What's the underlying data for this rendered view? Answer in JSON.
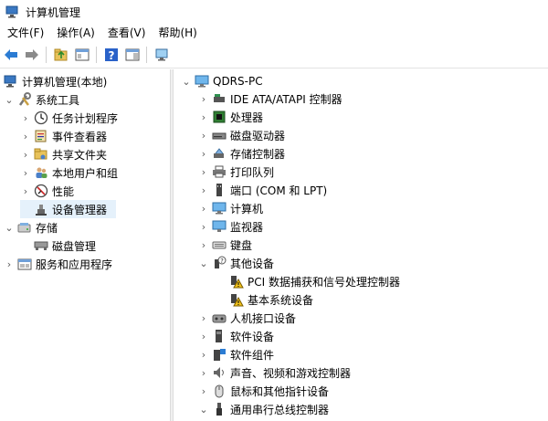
{
  "window": {
    "title": "计算机管理"
  },
  "menu": [
    {
      "label": "文件(F)"
    },
    {
      "label": "操作(A)"
    },
    {
      "label": "查看(V)"
    },
    {
      "label": "帮助(H)"
    }
  ],
  "left_tree": [
    {
      "label": "计算机管理(本地)",
      "icon": "computer-management-icon"
    },
    {
      "label": "系统工具",
      "icon": "system-tools-icon"
    },
    {
      "label": "任务计划程序",
      "icon": "clock-icon"
    },
    {
      "label": "事件查看器",
      "icon": "event-viewer-icon"
    },
    {
      "label": "共享文件夹",
      "icon": "shared-folder-icon"
    },
    {
      "label": "本地用户和组",
      "icon": "users-icon"
    },
    {
      "label": "性能",
      "icon": "performance-icon"
    },
    {
      "label": "设备管理器",
      "icon": "device-manager-icon",
      "selected": true
    },
    {
      "label": "存储",
      "icon": "storage-icon"
    },
    {
      "label": "磁盘管理",
      "icon": "disk-management-icon"
    },
    {
      "label": "服务和应用程序",
      "icon": "services-icon"
    }
  ],
  "device_tree": {
    "root": {
      "label": "QDRS-PC",
      "icon": "computer-icon"
    },
    "items": [
      {
        "label": "IDE ATA/ATAPI 控制器",
        "icon": "ide-controller-icon"
      },
      {
        "label": "处理器",
        "icon": "processor-icon"
      },
      {
        "label": "磁盘驱动器",
        "icon": "disk-drive-icon"
      },
      {
        "label": "存储控制器",
        "icon": "storage-controller-icon"
      },
      {
        "label": "打印队列",
        "icon": "printer-icon"
      },
      {
        "label": "端口 (COM 和 LPT)",
        "icon": "port-icon"
      },
      {
        "label": "计算机",
        "icon": "computer-icon"
      },
      {
        "label": "监视器",
        "icon": "monitor-icon"
      },
      {
        "label": "键盘",
        "icon": "keyboard-icon"
      },
      {
        "label": "其他设备",
        "icon": "unknown-device-icon"
      },
      {
        "label": "PCI 数据捕获和信号处理控制器",
        "icon": "warning-device-icon"
      },
      {
        "label": "基本系统设备",
        "icon": "warning-device-icon"
      },
      {
        "label": "人机接口设备",
        "icon": "hid-icon"
      },
      {
        "label": "软件设备",
        "icon": "software-device-icon"
      },
      {
        "label": "软件组件",
        "icon": "software-component-icon"
      },
      {
        "label": "声音、视频和游戏控制器",
        "icon": "sound-icon"
      },
      {
        "label": "鼠标和其他指针设备",
        "icon": "mouse-icon"
      },
      {
        "label": "通用串行总线控制器",
        "icon": "usb-icon"
      }
    ]
  }
}
